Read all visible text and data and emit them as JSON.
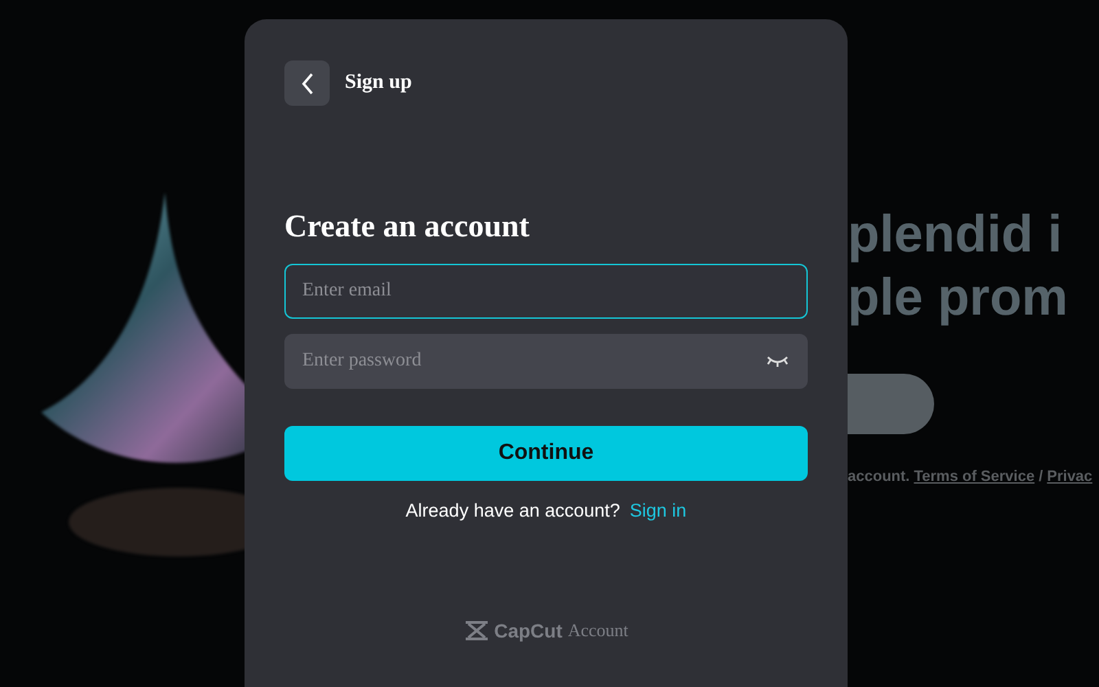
{
  "background": {
    "headline_lines": [
      "plendid i",
      "ple prom"
    ],
    "footer_text": "account.",
    "links": [
      "Terms of Service",
      "Privac"
    ],
    "separator": "/"
  },
  "dialog": {
    "back_title": "Sign up",
    "heading": "Create an account",
    "fields": [
      {
        "kind": "email",
        "placeholder": "Enter email",
        "focused": true
      },
      {
        "kind": "password",
        "placeholder": "Enter password",
        "focused": false
      }
    ],
    "continue_button": "Continue",
    "signin_prompt": "Already have an account?",
    "signin_link": "Sign in",
    "brand": "CapCut",
    "brand_suffix": "Account"
  }
}
